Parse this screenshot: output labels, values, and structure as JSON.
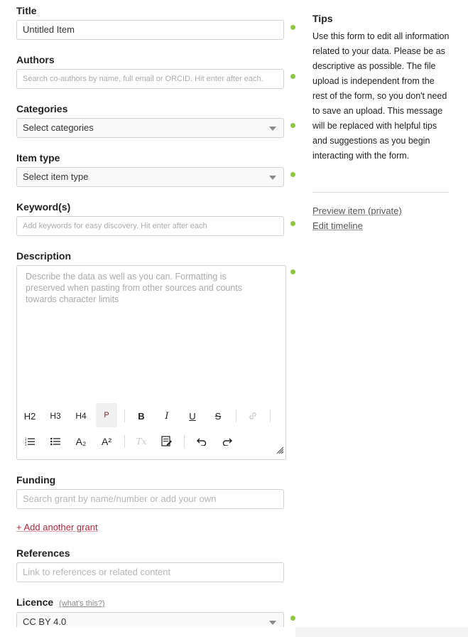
{
  "title": {
    "label": "Title",
    "value": "Untitled Item"
  },
  "authors": {
    "label": "Authors",
    "placeholder": "Search co-authors by name, full email or ORCID. Hit enter after each."
  },
  "categories": {
    "label": "Categories",
    "value": "Select categories"
  },
  "item_type": {
    "label": "Item type",
    "value": "Select item type"
  },
  "keywords": {
    "label": "Keyword(s)",
    "placeholder": "Add keywords for easy discovery. Hit enter after each"
  },
  "description": {
    "label": "Description",
    "placeholder": "Describe the data as well as you can. Formatting is preserved when pasting from other sources and counts towards character limits",
    "toolbar": {
      "h2": "H2",
      "h3": "H3",
      "h4": "H4",
      "p": "P",
      "bold": "B",
      "italic": "I",
      "underline": "U",
      "strike": "S",
      "subscript": "A₂",
      "superscript": "A²",
      "clear": "Tx"
    }
  },
  "funding": {
    "label": "Funding",
    "placeholder": "Search grant by name/number or add your own",
    "add_link": "+ Add another grant"
  },
  "references": {
    "label": "References",
    "placeholder": "Link to references or related content"
  },
  "licence": {
    "label": "Licence",
    "help_link": "(what's this?)",
    "value": "CC BY 4.0"
  },
  "tips": {
    "title": "Tips",
    "text": "Use this form to edit all information related to your data. Please be as descriptive as possible. The file upload is independent from the rest of the form, so you don't need to save an upload. This message will be replaced with helpful tips and suggestions as you begin interacting with the form.",
    "preview_link": "Preview item (private)",
    "timeline_link": "Edit timeline"
  },
  "colors": {
    "status_dot": "#8dc63f",
    "link_accent": "#b0283d"
  }
}
